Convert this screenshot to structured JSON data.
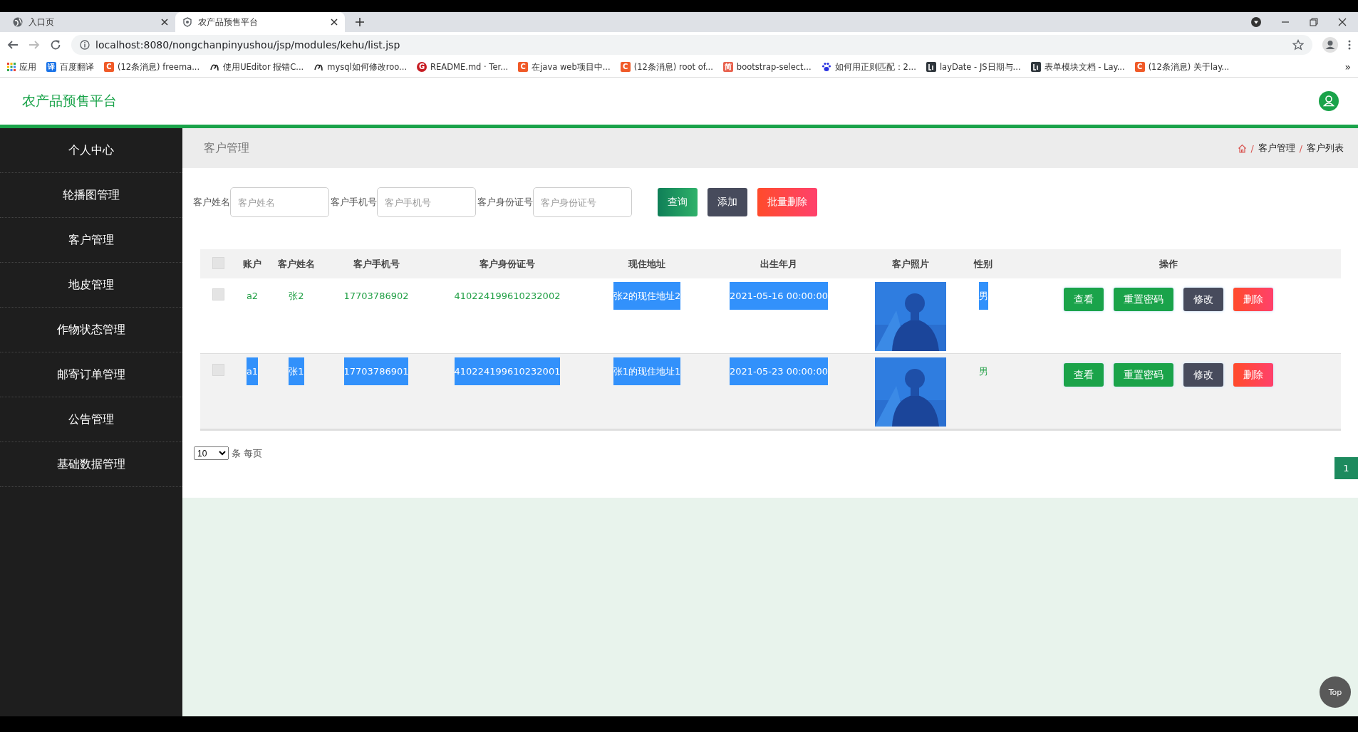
{
  "browser": {
    "tabs": [
      {
        "title": "入口页",
        "selected": false
      },
      {
        "title": "农产品预售平台",
        "selected": true
      }
    ],
    "url": "localhost:8080/nongchanpinyushou/jsp/modules/kehu/list.jsp",
    "bookmarks": [
      {
        "kind": "apps",
        "label": "应用"
      },
      {
        "kind": "square",
        "badge": "译",
        "color": "#1a73e8",
        "label": "百度翻译"
      },
      {
        "kind": "square",
        "badge": "C",
        "color": "#f05a28",
        "label": "(12条消息) freema..."
      },
      {
        "kind": "swirl",
        "label": "使用UEditor 报错C..."
      },
      {
        "kind": "swirl",
        "label": "mysql如何修改roo..."
      },
      {
        "kind": "circle",
        "badge": "G",
        "color": "#c71d23",
        "label": "README.md · Ter..."
      },
      {
        "kind": "square",
        "badge": "C",
        "color": "#f05a28",
        "label": "在java web项目中..."
      },
      {
        "kind": "square",
        "badge": "C",
        "color": "#f05a28",
        "label": "(12条消息) root of..."
      },
      {
        "kind": "square",
        "badge": "简",
        "color": "#e8614d",
        "label": "bootstrap-select..."
      },
      {
        "kind": "paw",
        "label": "如何用正则匹配：2..."
      },
      {
        "kind": "dark",
        "label": "layDate - JS日期与..."
      },
      {
        "kind": "dark",
        "label": "表单模块文档 - Lay..."
      },
      {
        "kind": "square",
        "badge": "C",
        "color": "#f05a28",
        "label": "(12条消息) 关于lay..."
      }
    ],
    "more": "»"
  },
  "app": {
    "brand": "农产品预售平台",
    "sidebar": {
      "items": [
        "个人中心",
        "轮播图管理",
        "客户管理",
        "地皮管理",
        "作物状态管理",
        "邮寄订单管理",
        "公告管理",
        "基础数据管理"
      ]
    },
    "page_title": "客户管理",
    "breadcrumb": [
      "客户管理",
      "客户列表"
    ],
    "breadcrumb_separator": "/",
    "search": [
      {
        "label": "客户姓名",
        "placeholder": "客户姓名"
      },
      {
        "label": "客户手机号",
        "placeholder": "客户手机号"
      },
      {
        "label": "客户身份证号",
        "placeholder": "客户身份证号"
      }
    ],
    "buttons": [
      {
        "kind": "query",
        "label": "查询"
      },
      {
        "kind": "add",
        "label": "添加"
      },
      {
        "kind": "delete",
        "label": "批量删除"
      }
    ],
    "table": {
      "columns": [
        "账户",
        "客户姓名",
        "客户手机号",
        "客户身份证号",
        "现住地址",
        "出生年月",
        "客户照片",
        "性别",
        "操作"
      ],
      "header_checked": false,
      "rows": [
        {
          "checked": false,
          "cells": [
            {
              "text": "a2",
              "highlighted": false
            },
            {
              "text": "张2",
              "highlighted": false
            },
            {
              "text": "17703786902",
              "highlighted": false
            },
            {
              "text": "410224199610232002",
              "highlighted": false
            },
            {
              "text": "张2的现住地址2",
              "highlighted": true
            },
            {
              "text": "2021-05-16 00:00:00",
              "highlighted": true
            },
            {
              "kind": "picture"
            },
            {
              "text": "男",
              "highlighted": true
            }
          ],
          "actions": [
            {
              "kind": "view",
              "label": "查看"
            },
            {
              "kind": "reset",
              "label": "重置密码"
            },
            {
              "kind": "edit",
              "label": "修改"
            },
            {
              "kind": "delete",
              "label": "删除"
            }
          ]
        },
        {
          "checked": false,
          "cells": [
            {
              "text": "a1",
              "highlighted": true
            },
            {
              "text": "张1",
              "highlighted": true
            },
            {
              "text": "17703786901",
              "highlighted": true
            },
            {
              "text": "410224199610232001",
              "highlighted": true
            },
            {
              "text": "张1的现住地址1",
              "highlighted": true
            },
            {
              "text": "2021-05-23 00:00:00",
              "highlighted": true
            },
            {
              "kind": "picture"
            },
            {
              "text": "男",
              "highlighted": false
            }
          ],
          "actions": [
            {
              "kind": "view",
              "label": "查看"
            },
            {
              "kind": "reset",
              "label": "重置密码"
            },
            {
              "kind": "edit",
              "label": "修改"
            },
            {
              "kind": "delete",
              "label": "删除"
            }
          ]
        }
      ]
    },
    "page_size": {
      "value": "10",
      "label": "条 每页"
    },
    "pages": [
      {
        "label": "1",
        "selected": true
      }
    ],
    "top_button": "Top"
  }
}
